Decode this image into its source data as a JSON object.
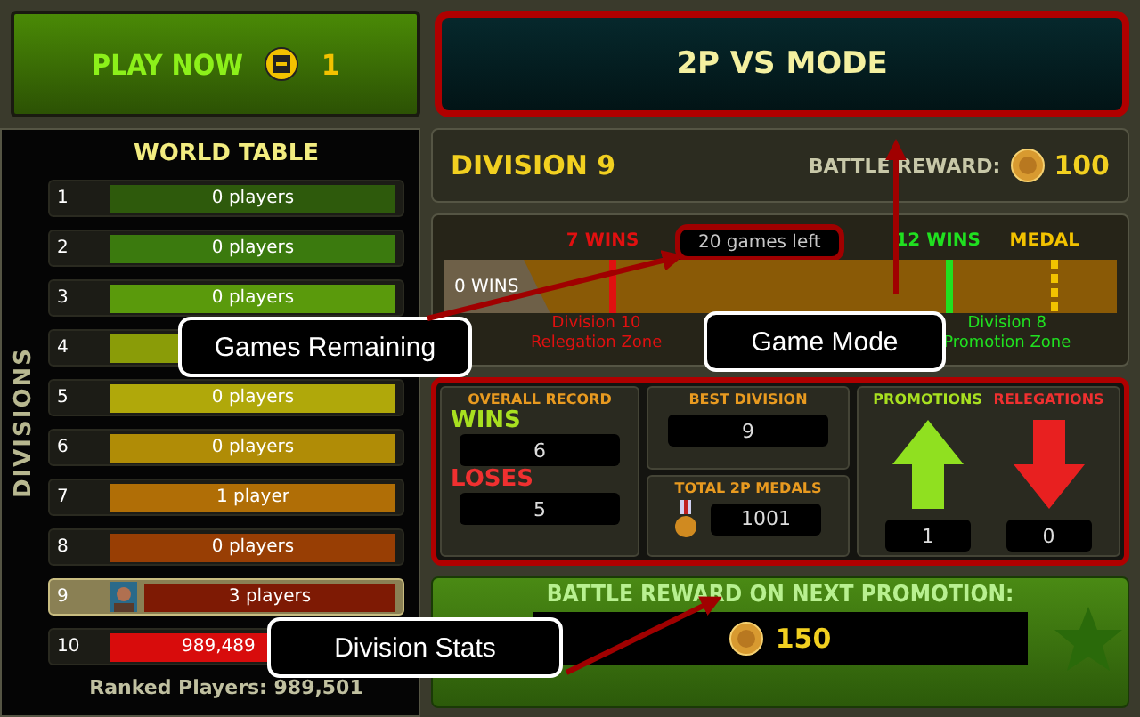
{
  "top_buttons": {
    "play_now": {
      "label": "PLAY NOW",
      "tickets": "1"
    },
    "vs_mode": {
      "label": "2P VS MODE"
    }
  },
  "world_table": {
    "side_label": "DIVISIONS",
    "title": "WORLD TABLE",
    "rows": [
      {
        "division": "1",
        "players": "0 players",
        "color": "#2e5a0c",
        "selected": false
      },
      {
        "division": "2",
        "players": "0 players",
        "color": "#3b7a0e",
        "selected": false
      },
      {
        "division": "3",
        "players": "0 players",
        "color": "#5a9a0c",
        "selected": false
      },
      {
        "division": "4",
        "color": "#8a9c08",
        "selected": false
      },
      {
        "division": "5",
        "players": "0 players",
        "color": "#b0a80a",
        "selected": false
      },
      {
        "division": "6",
        "players": "0 players",
        "color": "#b08c06",
        "selected": false
      },
      {
        "division": "7",
        "players": "1 player",
        "color": "#b06e06",
        "selected": false
      },
      {
        "division": "8",
        "players": "0 players",
        "color": "#983e04",
        "selected": false
      },
      {
        "division": "9",
        "players": "3 players",
        "color": "#7e1a04",
        "selected": true
      },
      {
        "division": "10",
        "players": "989,489",
        "color": "#d80c0c",
        "selected": false,
        "covered": true
      }
    ],
    "ranked": "Ranked Players: 989,501"
  },
  "division": {
    "title": "DIVISION 9",
    "reward_label": "BATTLE REWARD:",
    "reward": "100"
  },
  "progress": {
    "start": "0 WINS",
    "games_left": "20 games left",
    "marks": [
      {
        "kind": "relegation",
        "label": "7 WINS",
        "zone": "Division 10 Relegation Zone"
      },
      {
        "kind": "promotion",
        "label": "12 WINS",
        "zone": "Division 8 Promotion Zone"
      },
      {
        "kind": "medal",
        "label": "MEDAL"
      }
    ]
  },
  "stats": {
    "overall_title": "OVERALL RECORD",
    "wins_label": "WINS",
    "wins": "6",
    "loses_label": "LOSES",
    "loses": "5",
    "best_title": "BEST DIVISION",
    "best": "9",
    "medals_title": "TOTAL 2P MEDALS",
    "medals": "1001",
    "promotions_title": "PROMOTIONS",
    "promotions": "1",
    "relegations_title": "RELEGATIONS",
    "relegations": "0"
  },
  "next_reward": {
    "title": "BATTLE REWARD ON NEXT PROMOTION:",
    "amount": "150"
  },
  "callouts": [
    {
      "text": "Games Remaining"
    },
    {
      "text": "Game Mode"
    },
    {
      "text": "Division Stats"
    }
  ]
}
